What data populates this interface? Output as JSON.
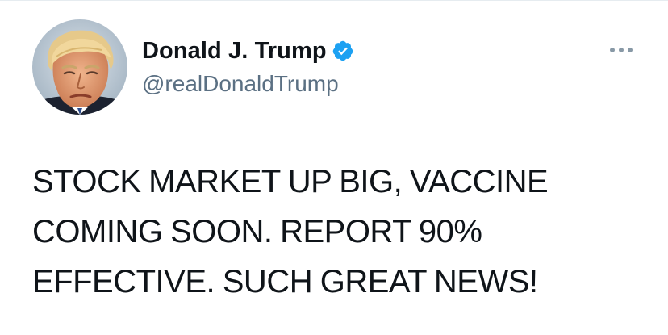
{
  "tweet": {
    "author": {
      "display_name": "Donald J. Trump",
      "handle": "@realDonaldTrump",
      "verified": true,
      "avatar_icon": "profile-photo-avatar"
    },
    "more_icon": "more-options-ellipsis-icon",
    "verified_icon": "verified-badge-icon",
    "text": "STOCK MARKET UP BIG, VACCINE\nCOMING SOON. REPORT 90%\nEFFECTIVE. SUCH GREAT NEWS!"
  },
  "colors": {
    "name": "#0f1419",
    "handle": "#5b7083",
    "verified_badge": "#1da1f2",
    "more_dots": "#8899a6",
    "divider": "#e6ecf0",
    "background": "#ffffff"
  }
}
